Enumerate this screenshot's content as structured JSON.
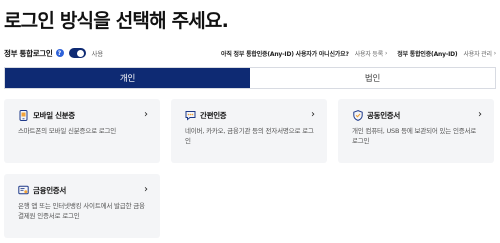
{
  "page": {
    "title": "로그인 방식을 선택해 주세요."
  },
  "topbar": {
    "toggle_label": "정부 통합로그인",
    "help_glyph": "?",
    "toggle_state": "사용",
    "signup_question": "아직 정부 통합인증(Any-ID) 사용자가 아니신가요?",
    "signup_link": "사용자 등록",
    "manage_question": "정부 통합인증(Any-ID)",
    "manage_link": "사용자 관리"
  },
  "tabs": [
    {
      "label": "개인",
      "active": true
    },
    {
      "label": "법인",
      "active": false
    }
  ],
  "cards": [
    {
      "title": "모바일 신분증",
      "icon": "phone-icon",
      "desc": "스마트폰의 모바일 신분증으로 로그인"
    },
    {
      "title": "간편인증",
      "icon": "chat-icon",
      "desc": "네이버, 카카오, 금융기관 등의 전자서명으로 로그인"
    },
    {
      "title": "공동인증서",
      "icon": "shield-icon",
      "desc": "개인 컴퓨터, USB 등에 보관되어 있는 인증서로 로그인"
    },
    {
      "title": "금융인증서",
      "icon": "certificate-icon",
      "desc": "은행 앱 또는 인터넷뱅킹 사이트에서 발급한 금융결제원 인증서로 로그인"
    }
  ],
  "colors": {
    "primary_navy": "#0e2a73",
    "help_blue": "#2e62d9",
    "card_bg": "#f4f5f7"
  }
}
